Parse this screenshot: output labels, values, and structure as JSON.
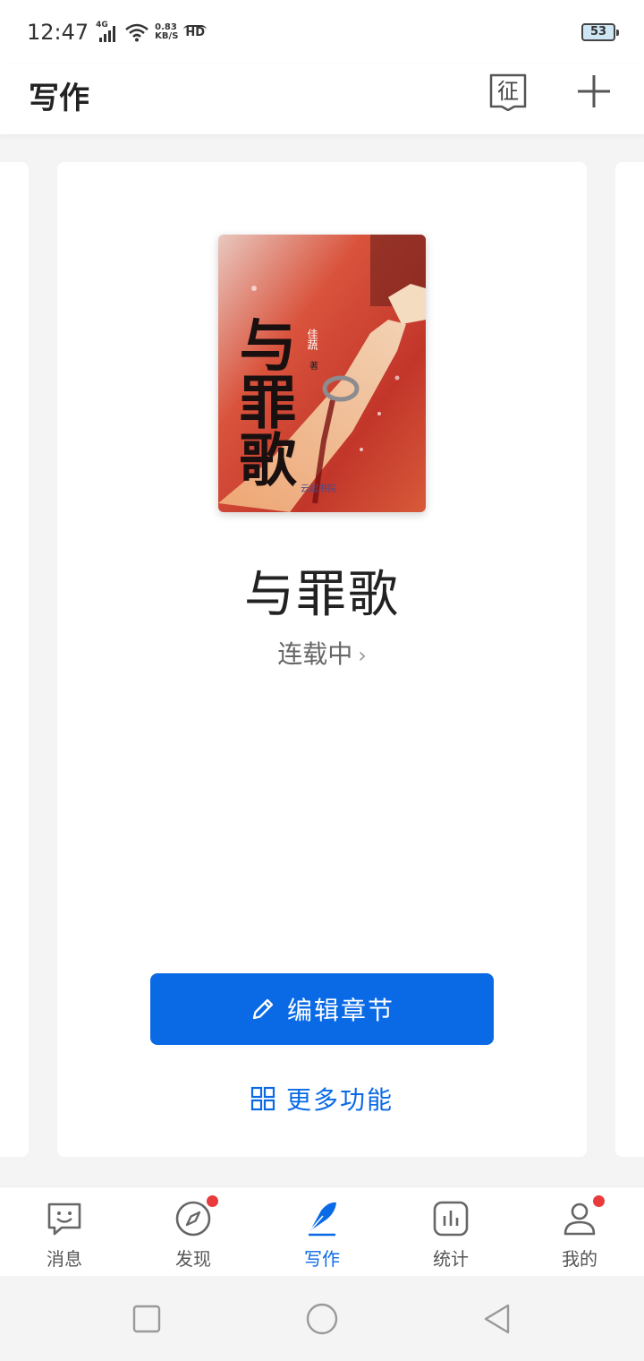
{
  "status_bar": {
    "time": "12:47",
    "network": "4G",
    "net_speed_value": "0.83",
    "net_speed_unit": "KB/S",
    "hd": "HD",
    "battery": "53"
  },
  "header": {
    "title": "写作",
    "contest_icon_text": "征"
  },
  "book": {
    "cover": {
      "title_text": "与罪歌",
      "author_text": "佳蔬",
      "author_suffix": "著",
      "publisher_mark": "云起书院"
    },
    "title": "与罪歌",
    "status": "连载中",
    "edit_label": "编辑章节",
    "more_label": "更多功能"
  },
  "tabs": [
    {
      "label": "消息",
      "icon": "message-smile-icon",
      "active": false,
      "badge": false
    },
    {
      "label": "发现",
      "icon": "compass-icon",
      "active": false,
      "badge": true
    },
    {
      "label": "写作",
      "icon": "feather-pen-icon",
      "active": true,
      "badge": false
    },
    {
      "label": "统计",
      "icon": "bar-chart-icon",
      "active": false,
      "badge": false
    },
    {
      "label": "我的",
      "icon": "user-icon",
      "active": false,
      "badge": true
    }
  ],
  "colors": {
    "accent": "#0a6ae6",
    "badge": "#e93b3b",
    "background": "#f4f4f4"
  }
}
